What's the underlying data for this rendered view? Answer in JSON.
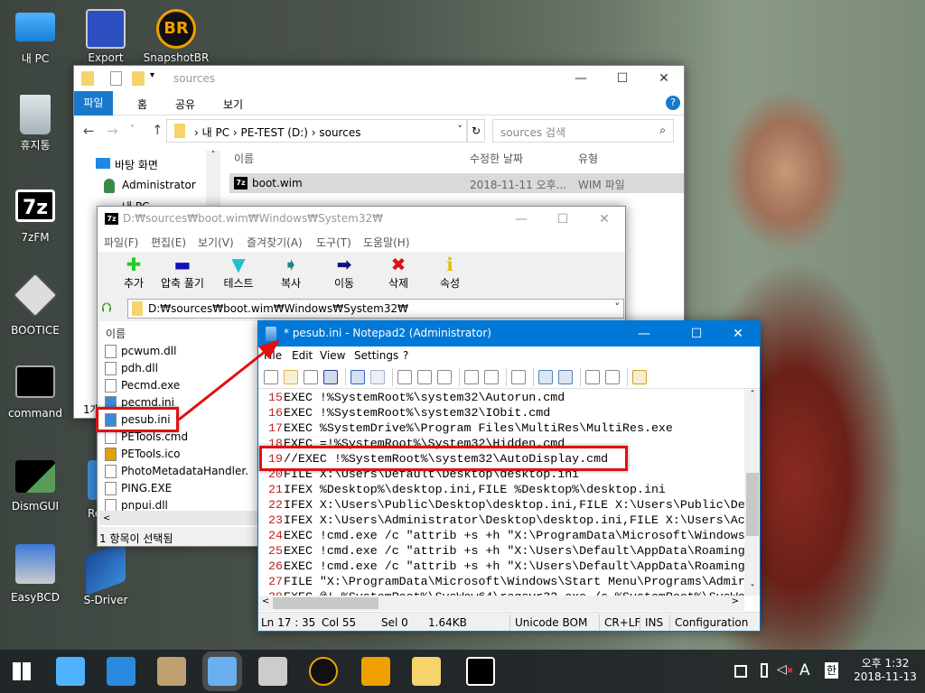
{
  "desktop": {
    "icons": [
      {
        "label": "내 PC",
        "icon": "computer-icon"
      },
      {
        "label": "휴지통",
        "icon": "recycle-bin-icon"
      },
      {
        "label": "7zFM",
        "icon": "7zip-icon"
      },
      {
        "label": "BOOTICE",
        "icon": "floppy-icon"
      },
      {
        "label": "command",
        "icon": "console-icon"
      },
      {
        "label": "DismGUI",
        "icon": "console-user-icon"
      },
      {
        "label": "EasyBCD",
        "icon": "easybcd-icon"
      },
      {
        "label": "Export",
        "icon": "export-icon"
      },
      {
        "label": "S-Driver",
        "icon": "graphics-card-icon"
      },
      {
        "label": "Re",
        "icon": "app-icon"
      },
      {
        "label": "SnapshotBR",
        "icon": "br-logo-icon"
      }
    ]
  },
  "explorer": {
    "title": "sources",
    "ribbon_tabs": [
      "파일",
      "홈",
      "공유",
      "보기"
    ],
    "breadcrumb": [
      "내 PC",
      "PE-TEST (D:)",
      "sources"
    ],
    "search_placeholder": "sources 검색",
    "nav_items": [
      "바탕 화면",
      "Administrator",
      "내 PC"
    ],
    "columns": [
      "이름",
      "수정한 날짜",
      "유형"
    ],
    "files": [
      {
        "name": "boot.wim",
        "date": "2018-11-11 오후...",
        "type": "WIM 파일"
      }
    ],
    "status": "1개"
  },
  "sevenzip": {
    "title": "D:₩sources₩boot.wim₩Windows₩System32₩",
    "menu": [
      "파일(F)",
      "편집(E)",
      "보기(V)",
      "즐겨찾기(A)",
      "도구(T)",
      "도움말(H)"
    ],
    "toolbar": [
      {
        "label": "추가",
        "icon": "add-icon",
        "color": "#22cc22"
      },
      {
        "label": "압축 풀기",
        "icon": "extract-icon",
        "color": "#1010c0"
      },
      {
        "label": "테스트",
        "icon": "test-icon",
        "color": "#20c0d0"
      },
      {
        "label": "복사",
        "icon": "copy-icon",
        "color": "#208080"
      },
      {
        "label": "이동",
        "icon": "move-icon",
        "color": "#101080"
      },
      {
        "label": "삭제",
        "icon": "delete-icon",
        "color": "#e01010"
      },
      {
        "label": "속성",
        "icon": "info-icon",
        "color": "#e0c000"
      }
    ],
    "path": "D:₩sources₩boot.wim₩Windows₩System32₩",
    "column": "이름",
    "files": [
      "pcwum.dll",
      "pdh.dll",
      "Pecmd.exe",
      "pecmd.ini",
      "pesub.ini",
      "PETools.cmd",
      "PETools.ico",
      "PhotoMetadataHandler.",
      "PING.EXE",
      "pnpui.dll"
    ],
    "highlighted_file": "pesub.ini",
    "status": "1 항목이 선택됨"
  },
  "notepad": {
    "title": "* pesub.ini - Notepad2 (Administrator)",
    "menu": [
      "File",
      "Edit",
      "View",
      "Settings",
      "?"
    ],
    "lines": [
      {
        "n": "15",
        "text": "EXEC !%SystemRoot%\\system32\\Autorun.cmd"
      },
      {
        "n": "16",
        "text": "EXEC !%SystemRoot%\\system32\\IObit.cmd"
      },
      {
        "n": "17",
        "text": "EXEC %SystemDrive%\\Program Files\\MultiRes\\MultiRes.exe"
      },
      {
        "n": "18",
        "text": "EXEC =!%SystemRoot%\\System32\\Hidden.cmd"
      },
      {
        "n": "19",
        "text": "//EXEC !%SystemRoot%\\system32\\AutoDisplay.cmd"
      },
      {
        "n": "20",
        "text": "FILE X:\\Users\\Default\\Desktop\\desktop.ini"
      },
      {
        "n": "21",
        "text": "IFEX %Desktop%\\desktop.ini,FILE %Desktop%\\desktop.ini"
      },
      {
        "n": "22",
        "text": "IFEX X:\\Users\\Public\\Desktop\\desktop.ini,FILE X:\\Users\\Public\\De"
      },
      {
        "n": "23",
        "text": "IFEX X:\\Users\\Administrator\\Desktop\\desktop.ini,FILE X:\\Users\\Ac"
      },
      {
        "n": "24",
        "text": "EXEC !cmd.exe /c \"attrib +s +h \"X:\\ProgramData\\Microsoft\\Windows"
      },
      {
        "n": "25",
        "text": "EXEC !cmd.exe /c \"attrib +s +h \"X:\\Users\\Default\\AppData\\Roaming"
      },
      {
        "n": "26",
        "text": "EXEC !cmd.exe /c \"attrib +s +h \"X:\\Users\\Default\\AppData\\Roaming"
      },
      {
        "n": "27",
        "text": "FILE \"X:\\ProgramData\\Microsoft\\Windows\\Start Menu\\Programs\\Admir"
      },
      {
        "n": "28",
        "text": "EXEC @!.%SystemRoot%\\SysWow64\\regsvr32.exe /s %SystemRoot%\\SysWo"
      }
    ],
    "highlighted_line": "19",
    "status": [
      "Ln 17 : 35",
      "Col 55",
      "Sel 0",
      "1.64KB",
      "Unicode BOM",
      "CR+LF",
      "INS",
      "Configuration"
    ]
  },
  "taskbar": {
    "apps": [
      "start-icon",
      "my-pc-icon",
      "internet-explorer-icon",
      "media-icon",
      "notepad2-icon",
      "drive-icon",
      "snapshotbr-icon",
      "power-icon",
      "folder-icon",
      "7zip-icon"
    ],
    "tray": {
      "ime_a": "A",
      "ime_han": "한",
      "time": "오후 1:32",
      "date": "2018-11-13"
    }
  },
  "colors": {
    "accent": "#0078d7",
    "annotation": "#e01010"
  }
}
